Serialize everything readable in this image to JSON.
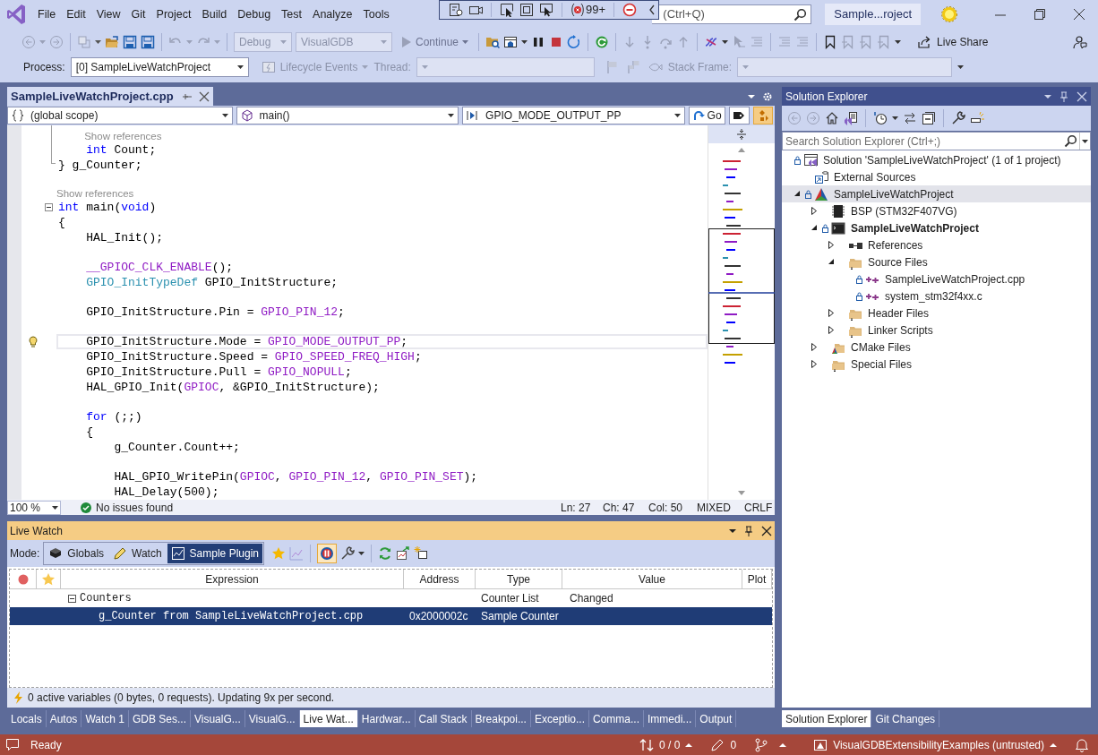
{
  "menu": [
    "File",
    "Edit",
    "View",
    "Git",
    "Project",
    "Build",
    "Debug",
    "Test",
    "Analyze",
    "Tools"
  ],
  "debug_toolbar": {
    "error_count": "99+"
  },
  "search": {
    "placeholder": "(Ctrl+Q)"
  },
  "window": {
    "title": "Sample...roject"
  },
  "toolbar": {
    "configuration": {
      "text": "Debug",
      "disabled": true
    },
    "platform": {
      "text": "VisualGDB",
      "disabled": true
    },
    "continue": "Continue",
    "live_share": "Live Share"
  },
  "debug_location": {
    "process_label": "Process:",
    "process": "[0] SampleLiveWatchProject",
    "lifecycle": {
      "text": "Lifecycle Events",
      "disabled": true
    },
    "thread": {
      "text": "Thread:",
      "disabled": true
    },
    "stack_frame": {
      "text": "Stack Frame:",
      "disabled": true
    }
  },
  "editor": {
    "tab": {
      "title": "SampleLiveWatchProject.cpp",
      "selected": true
    },
    "nav": [
      {
        "kind": "scope",
        "text": "(global scope)"
      },
      {
        "kind": "function",
        "text": "main()"
      },
      {
        "kind": "member",
        "text": "GPIO_MODE_OUTPUT_PP"
      }
    ],
    "go": "Go",
    "lines": [
      {
        "kind": "hint",
        "text": "Show references"
      },
      {
        "kind": "code",
        "current": false,
        "segments": [
          {
            "text": "    int",
            "kind": "kw"
          },
          {
            "text": " Count;",
            "kind": "p"
          }
        ]
      },
      {
        "kind": "code",
        "current": false,
        "segments": [
          {
            "text": "} g_Counter;",
            "kind": "p"
          }
        ]
      },
      {
        "kind": "blank"
      },
      {
        "kind": "hint",
        "text": "Show references"
      },
      {
        "kind": "code",
        "current": false,
        "expanded": true,
        "segments": [
          {
            "text": "int",
            "kind": "kw"
          },
          {
            "text": " main(",
            "kind": "p"
          },
          {
            "text": "void",
            "kind": "kw"
          },
          {
            "text": ")",
            "kind": "p"
          }
        ]
      },
      {
        "kind": "code",
        "current": false,
        "segments": [
          {
            "text": "{",
            "kind": "p"
          }
        ]
      },
      {
        "kind": "code",
        "current": false,
        "segments": [
          {
            "text": "    HAL_Init();",
            "kind": "p"
          }
        ]
      },
      {
        "kind": "blank"
      },
      {
        "kind": "code",
        "current": false,
        "segments": [
          {
            "text": "    __GPIOC_CLK_ENABLE",
            "kind": "macro"
          },
          {
            "text": "();",
            "kind": "p"
          }
        ]
      },
      {
        "kind": "code",
        "current": false,
        "segments": [
          {
            "text": "    GPIO_InitTypeDef",
            "kind": "type"
          },
          {
            "text": " GPIO_InitStructure;",
            "kind": "p"
          }
        ]
      },
      {
        "kind": "blank"
      },
      {
        "kind": "code",
        "current": false,
        "segments": [
          {
            "text": "    GPIO_InitStructure.Pin = ",
            "kind": "p"
          },
          {
            "text": "GPIO_PIN_12",
            "kind": "macro"
          },
          {
            "text": ";",
            "kind": "p"
          }
        ]
      },
      {
        "kind": "blank"
      },
      {
        "kind": "code",
        "current": true,
        "segments": [
          {
            "text": "    GPIO_InitStructure.Mode = ",
            "kind": "p"
          },
          {
            "text": "GPIO_MODE_OUTPUT_PP",
            "kind": "macro"
          },
          {
            "text": ";",
            "kind": "p"
          }
        ]
      },
      {
        "kind": "code",
        "current": false,
        "segments": [
          {
            "text": "    GPIO_InitStructure.Speed = ",
            "kind": "p"
          },
          {
            "text": "GPIO_SPEED_FREQ_HIGH",
            "kind": "macro"
          },
          {
            "text": ";",
            "kind": "p"
          }
        ]
      },
      {
        "kind": "code",
        "current": false,
        "segments": [
          {
            "text": "    GPIO_InitStructure.Pull = ",
            "kind": "p"
          },
          {
            "text": "GPIO_NOPULL",
            "kind": "macro"
          },
          {
            "text": ";",
            "kind": "p"
          }
        ]
      },
      {
        "kind": "code",
        "current": false,
        "segments": [
          {
            "text": "    HAL_GPIO_Init(",
            "kind": "p"
          },
          {
            "text": "GPIOC",
            "kind": "macro"
          },
          {
            "text": ", &GPIO_InitStructure);",
            "kind": "p"
          }
        ]
      },
      {
        "kind": "blank"
      },
      {
        "kind": "code",
        "current": false,
        "segments": [
          {
            "text": "    for",
            "kind": "kw"
          },
          {
            "text": " (;;)",
            "kind": "p"
          }
        ]
      },
      {
        "kind": "code",
        "current": false,
        "segments": [
          {
            "text": "    {",
            "kind": "p"
          }
        ]
      },
      {
        "kind": "code",
        "current": false,
        "segments": [
          {
            "text": "        g_Counter.Count++;",
            "kind": "p"
          }
        ]
      },
      {
        "kind": "blank"
      },
      {
        "kind": "code",
        "current": false,
        "segments": [
          {
            "text": "        HAL_GPIO_WritePin(",
            "kind": "p"
          },
          {
            "text": "GPIOC",
            "kind": "macro"
          },
          {
            "text": ", ",
            "kind": "p"
          },
          {
            "text": "GPIO_PIN_12",
            "kind": "macro"
          },
          {
            "text": ", ",
            "kind": "p"
          },
          {
            "text": "GPIO_PIN_SET",
            "kind": "macro"
          },
          {
            "text": ");",
            "kind": "p"
          }
        ]
      },
      {
        "kind": "code",
        "current": false,
        "segments": [
          {
            "text": "        HAL_Delay(500);",
            "kind": "p"
          }
        ]
      }
    ],
    "zoom": "100 %",
    "issues": "No issues found",
    "position": [
      "Ln: 27",
      "Ch: 47",
      "Col: 50",
      "MIXED",
      "CRLF"
    ]
  },
  "live_watch": {
    "title": "Live Watch",
    "mode_label": "Mode:",
    "modes": [
      {
        "label": "Globals",
        "selected": false
      },
      {
        "label": "Watch",
        "selected": false
      },
      {
        "label": "Sample Plugin",
        "selected": true
      }
    ],
    "columns": [
      "Expression",
      "Address",
      "Type",
      "Value",
      "Plot"
    ],
    "rows": [
      {
        "expression": "Counters",
        "type": "Counter List",
        "value": "Changed",
        "expanded": true,
        "selected": false,
        "children": [
          {
            "expression": "g_Counter from SampleLiveWatchProject.cpp",
            "address": "0x2000002c",
            "type": "Sample Counter",
            "selected": true
          }
        ]
      }
    ],
    "status": "0 active variables (0 bytes, 0 requests). Updating 9x per second."
  },
  "bottom_tabs": [
    {
      "label": "Locals",
      "selected": false
    },
    {
      "label": "Autos",
      "selected": false
    },
    {
      "label": "Watch 1",
      "selected": false
    },
    {
      "label": "GDB Ses...",
      "selected": false
    },
    {
      "label": "VisualG...",
      "selected": false
    },
    {
      "label": "VisualG...",
      "selected": false
    },
    {
      "label": "Live Wat...",
      "selected": true
    },
    {
      "label": "Hardwar...",
      "selected": false
    },
    {
      "label": "Call Stack",
      "selected": false
    },
    {
      "label": "Breakpoi...",
      "selected": false
    },
    {
      "label": "Exceptio...",
      "selected": false
    },
    {
      "label": "Comma...",
      "selected": false
    },
    {
      "label": "Immedi...",
      "selected": false
    },
    {
      "label": "Output",
      "selected": false
    }
  ],
  "solution_explorer": {
    "title": "Solution Explorer",
    "search": {
      "placeholder": "Search Solution Explorer (Ctrl+;)"
    },
    "tree": [
      {
        "label": "Solution 'SampleLiveWatchProject' (1 of 1 project)",
        "kind": "solution",
        "locked": true,
        "selected": false,
        "children": [
          {
            "label": "External Sources",
            "kind": "external",
            "locked": false,
            "selected": false
          },
          {
            "label": "SampleLiveWatchProject",
            "kind": "cmake-project",
            "locked": true,
            "selected": true,
            "expanded": true,
            "children": [
              {
                "label": "BSP (STM32F407VG)",
                "kind": "chip",
                "locked": false,
                "selected": false,
                "expanded": false
              },
              {
                "label": "SampleLiveWatchProject",
                "kind": "executable",
                "locked": true,
                "selected": false,
                "expanded": true,
                "startup": true,
                "children": [
                  {
                    "label": "References",
                    "kind": "references",
                    "locked": false,
                    "selected": false,
                    "expanded": false
                  },
                  {
                    "label": "Source Files",
                    "kind": "folder",
                    "locked": false,
                    "selected": false,
                    "expanded": true,
                    "children": [
                      {
                        "label": "SampleLiveWatchProject.cpp",
                        "kind": "cpp",
                        "locked": true,
                        "selected": false
                      },
                      {
                        "label": "system_stm32f4xx.c",
                        "kind": "cpp",
                        "locked": true,
                        "selected": false
                      }
                    ]
                  },
                  {
                    "label": "Header Files",
                    "kind": "folder",
                    "locked": false,
                    "selected": false,
                    "expanded": false
                  },
                  {
                    "label": "Linker Scripts",
                    "kind": "folder",
                    "locked": false,
                    "selected": false,
                    "expanded": false
                  }
                ]
              },
              {
                "label": "CMake Files",
                "kind": "cmake-folder",
                "locked": false,
                "selected": false,
                "expanded": false
              },
              {
                "label": "Special Files",
                "kind": "folder",
                "locked": false,
                "selected": false,
                "expanded": false
              }
            ]
          }
        ]
      }
    ]
  },
  "solution_tabs": [
    {
      "label": "Solution Explorer",
      "selected": true
    },
    {
      "label": "Git Changes",
      "selected": false
    }
  ],
  "status_bar": {
    "text": "Ready",
    "sync": "0 / 0",
    "changes": "0",
    "repository": "VisualGDBExtensibilityExamples (untrusted)"
  }
}
